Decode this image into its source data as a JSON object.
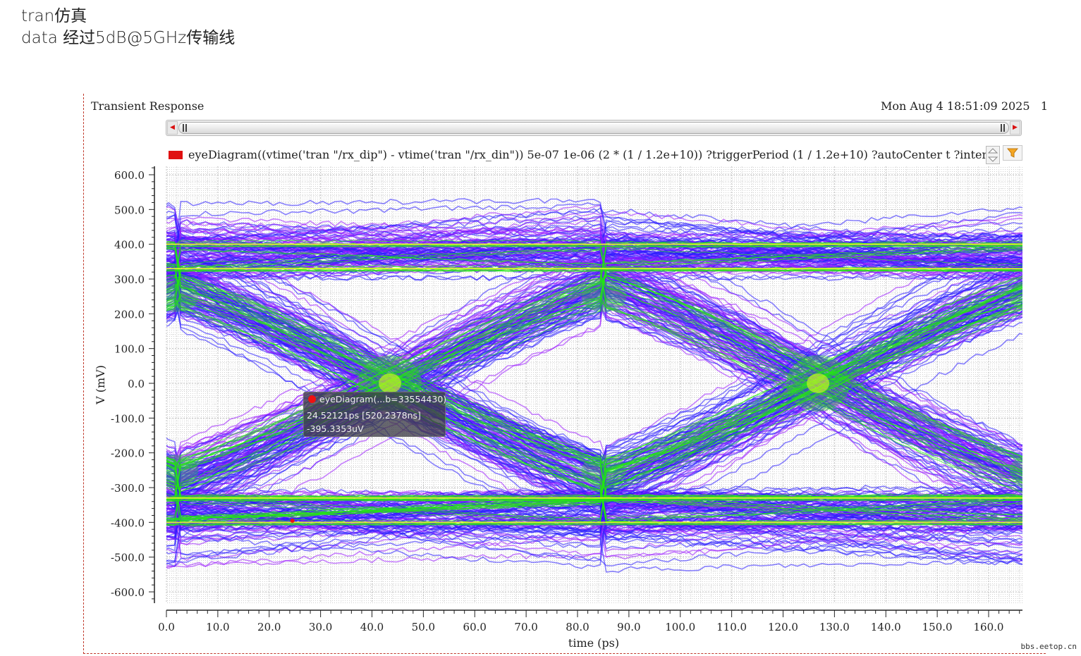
{
  "slide": {
    "line1": "tran仿真",
    "line2": "data 经过5dB@5GHz传输线"
  },
  "window": {
    "title": "Transient Response",
    "date": "Mon Aug 4 18:51:09 2025",
    "page_number": "1"
  },
  "legend": {
    "trace_label": "eyeDiagram((vtime('tran \"/rx_dip\") - vtime('tran \"/rx_din\")) 5e-07 1e-06 (2 * (1 / 1.2e+10)) ?triggerPeriod (1 / 1.2e+10) ?autoCenter t ?intensity",
    "trace_color": "#e01010",
    "icons": [
      "scroll-up-down-icon",
      "filter-icon"
    ]
  },
  "marker": {
    "title": "eyeDiagram(...b=33554430)",
    "line1": "24.52121ps [520.2378ns]",
    "line2": "-395.3353uV"
  },
  "watermark": "bbs.eetop.cn",
  "chart_data": {
    "type": "eye-diagram",
    "xlabel": "time (ps)",
    "ylabel": "V (mV)",
    "xlim": [
      0,
      166.67
    ],
    "ylim": [
      -600,
      600
    ],
    "x_ticks": [
      "0.0",
      "10.0",
      "20.0",
      "30.0",
      "40.0",
      "50.0",
      "60.0",
      "70.0",
      "80.0",
      "90.0",
      "100.0",
      "110.0",
      "120.0",
      "130.0",
      "140.0",
      "150.0",
      "160.0"
    ],
    "y_ticks": [
      "600.0",
      "500.0",
      "400.0",
      "300.0",
      "200.0",
      "100.0",
      "0.0",
      "-100.0",
      "-200.0",
      "-300.0",
      "-400.0",
      "-500.0",
      "-600.0"
    ],
    "unit_interval_ps": 83.33,
    "levels_mV": [
      400,
      330,
      -330,
      -400
    ],
    "outer_envelope_mV": [
      510,
      -530
    ],
    "crossings_ps": [
      43.5,
      126.8
    ],
    "colors": {
      "density_low": "#9a1bff",
      "density_mid": "#2a1cff",
      "density_high": "#22e810",
      "hot": "#f2ff20"
    },
    "grid": true,
    "marker_point": {
      "x": 24.52121,
      "y": -0.3953353
    }
  }
}
